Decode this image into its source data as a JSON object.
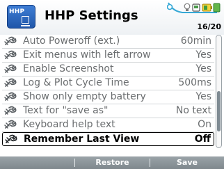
{
  "header": {
    "icon_text": "HHP",
    "title": "HHP Settings",
    "page_counter": "16/20"
  },
  "settings": [
    {
      "label": "Auto Poweroff (ext.)",
      "value": "60min"
    },
    {
      "label": "Exit menus with left arrow",
      "value": "Yes"
    },
    {
      "label": "Enable Screenshot",
      "value": "Yes"
    },
    {
      "label": "Log & Plot Cycle Time",
      "value": "500ms"
    },
    {
      "label": "Show only empty battery",
      "value": "Yes"
    },
    {
      "label": "Text for \"save as\"",
      "value": "No text"
    },
    {
      "label": "Keyboard help text",
      "value": "On"
    },
    {
      "label": "Remember Last View",
      "value": "Off"
    }
  ],
  "selected_index": 7,
  "scrollbar": {
    "position_fraction": 0.78
  },
  "softkeys": {
    "left": "",
    "middle": "Restore",
    "right": "Save"
  },
  "colors": {
    "accent": "#1f55a8",
    "text_inactive": "#6a6d6f",
    "text_selected": "#000000",
    "footer_bg": "#8a9398"
  },
  "icons": {
    "row_icon": "wrench-icon",
    "status": "status-indicators-icon"
  }
}
